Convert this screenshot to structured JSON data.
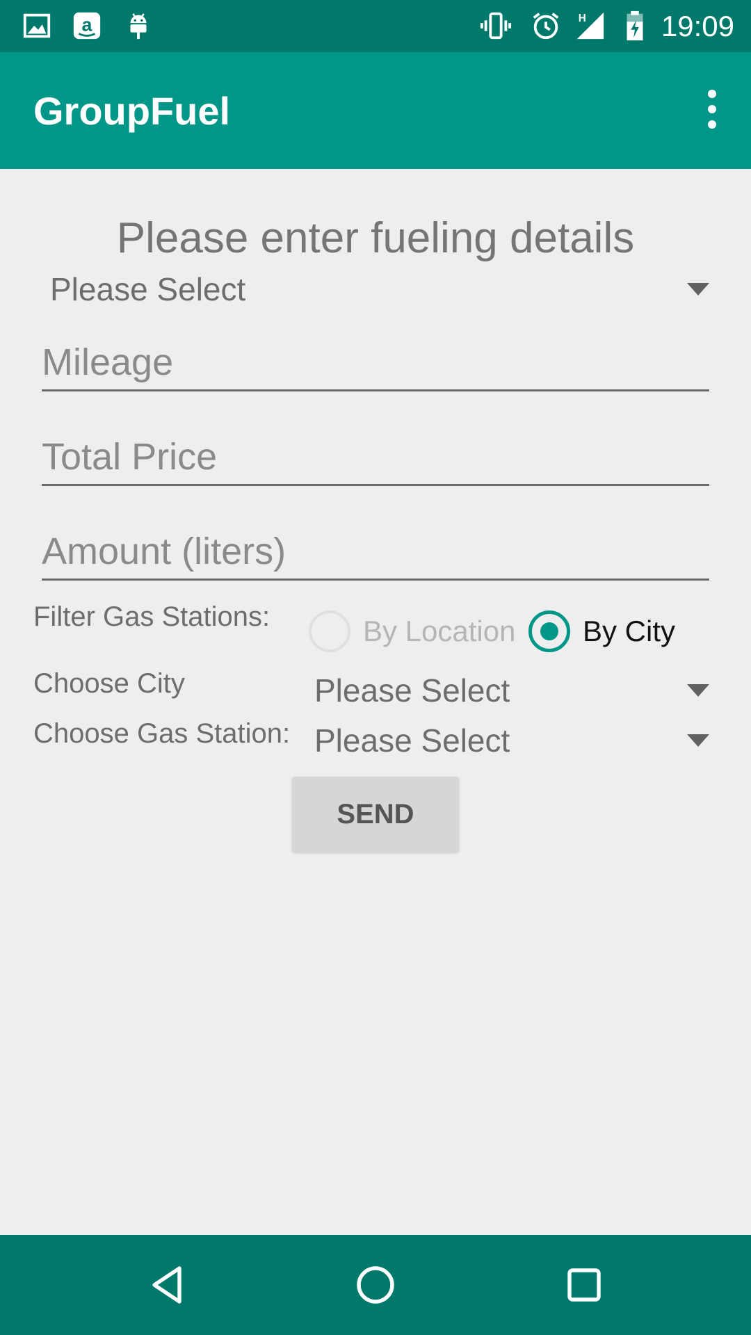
{
  "status_bar": {
    "time": "19:09",
    "left_icons": [
      "image-icon",
      "amazon-icon",
      "android-icon"
    ],
    "right_icons": [
      "vibrate-icon",
      "alarm-icon",
      "signal-h-icon",
      "battery-charging-icon"
    ]
  },
  "app_bar": {
    "title": "GroupFuel",
    "menu_icon": "overflow-menu-icon"
  },
  "form": {
    "heading": "Please enter fueling details",
    "car_select": "Please Select",
    "mileage_placeholder": "Mileage",
    "total_price_placeholder": "Total Price",
    "amount_placeholder": "Amount (liters)",
    "filter_label": "Filter Gas Stations:",
    "radio_location": "By Location",
    "radio_city": "By City",
    "selected_filter": "By City",
    "city_label": "Choose City",
    "city_value": "Please Select",
    "station_label": "Choose Gas Station:",
    "station_value": "Please Select",
    "send_label": "SEND"
  },
  "colors": {
    "status_bar": "#00796b",
    "app_bar": "#009688",
    "accent": "#009688",
    "background": "#eeeeee",
    "nav_bar": "#00796b"
  },
  "nav_bar": {
    "buttons": [
      "back-icon",
      "home-icon",
      "recents-icon"
    ]
  }
}
